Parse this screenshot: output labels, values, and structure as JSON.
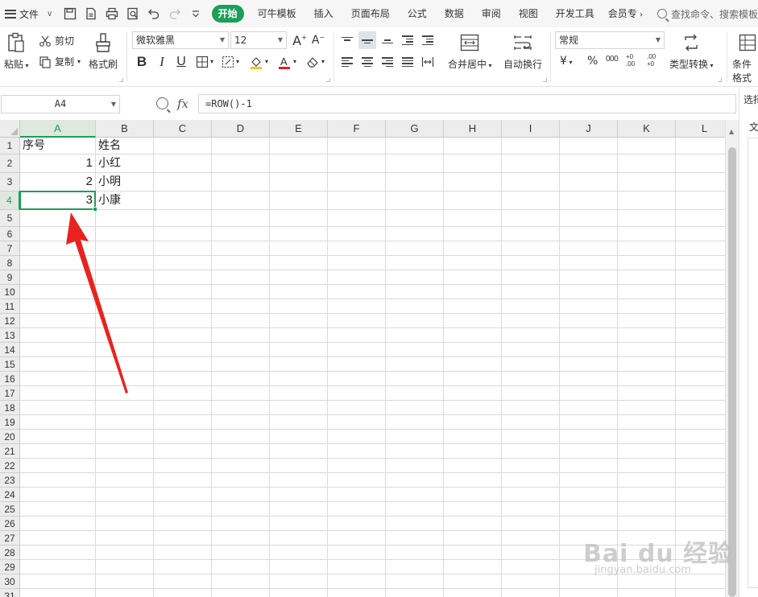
{
  "menubar": {
    "file_label": "文件",
    "quick_icons": [
      "save-icon",
      "export-pdf-icon",
      "print-icon",
      "print-preview-icon",
      "undo-icon",
      "redo-icon",
      "customize-icon"
    ],
    "tabs": [
      "开始",
      "可牛模板",
      "插入",
      "页面布局",
      "公式",
      "数据",
      "审阅",
      "视图",
      "开发工具",
      "会员专"
    ],
    "active_tab": "开始",
    "search_placeholder": "查找命令、搜索模板"
  },
  "ribbon": {
    "paste": "粘贴",
    "cut": "剪切",
    "copy": "复制",
    "format_painter": "格式刷",
    "font_name": "微软雅黑",
    "font_size": "12",
    "bold": "B",
    "italic": "I",
    "underline": "U",
    "merge_center": "合并居中",
    "wrap_text": "自动换行",
    "number_format": "常规",
    "currency": "¥",
    "percent": "%",
    "thousands": "000",
    "inc_decimal": "+0 .00",
    "dec_decimal": ".00 +0",
    "type_convert": "类型转换",
    "conditional_format": "条件格式",
    "accent_color": "#1aa058",
    "font_color": "#e02020",
    "fill_color": "#f5c518"
  },
  "formula_bar": {
    "name_box": "A4",
    "fx": "fx",
    "formula": "=ROW()-1"
  },
  "sheet": {
    "columns": [
      "A",
      "B",
      "C",
      "D",
      "E",
      "F",
      "G",
      "H",
      "I",
      "J",
      "K",
      "L"
    ],
    "rows": [
      "1",
      "2",
      "3",
      "4",
      "5",
      "6",
      "7",
      "8",
      "9",
      "10",
      "11",
      "12",
      "13",
      "14",
      "15",
      "16",
      "17",
      "18",
      "19",
      "20",
      "21",
      "22",
      "23",
      "24",
      "25",
      "26",
      "27",
      "28",
      "29",
      "30",
      "31"
    ],
    "active_cell": "A4",
    "cells": {
      "A1": "序号",
      "B1": "姓名",
      "A2": "1",
      "B2": "小红",
      "A3": "2",
      "B3": "小明",
      "A4": "3",
      "B4": "小康"
    }
  },
  "right_panel": {
    "label_top": "选择",
    "label_tab": "文"
  },
  "watermark": {
    "brand": "Bai du 经验",
    "url": "jingyan.baidu.com"
  },
  "annotation_color": "#e8231d"
}
